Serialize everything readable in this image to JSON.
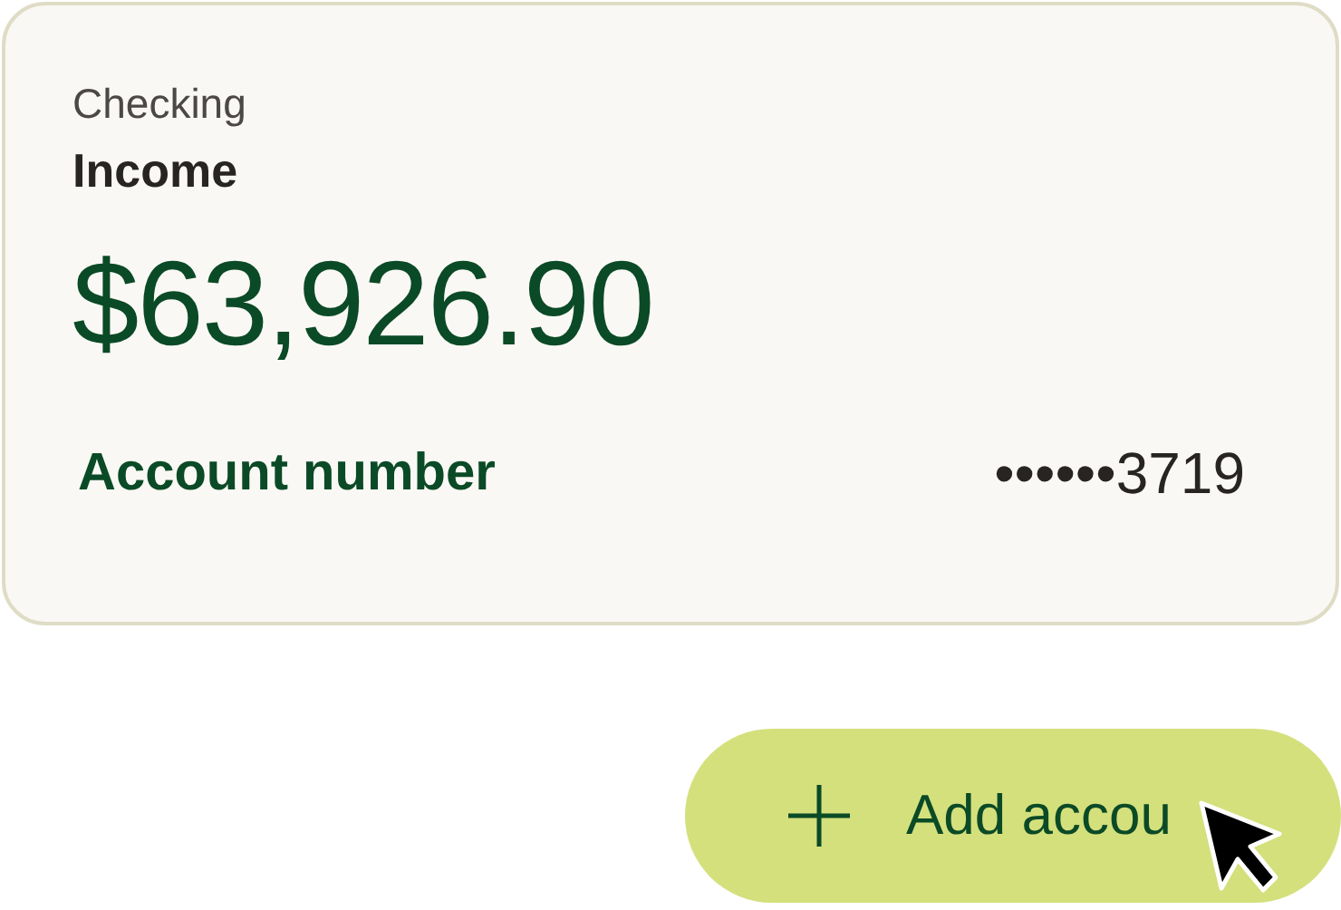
{
  "account_card": {
    "type": "Checking",
    "name": "Income",
    "balance": "$63,926.90",
    "number_label": "Account number",
    "number_value": "••••••3719"
  },
  "add_button": {
    "label": "Add accou"
  }
}
